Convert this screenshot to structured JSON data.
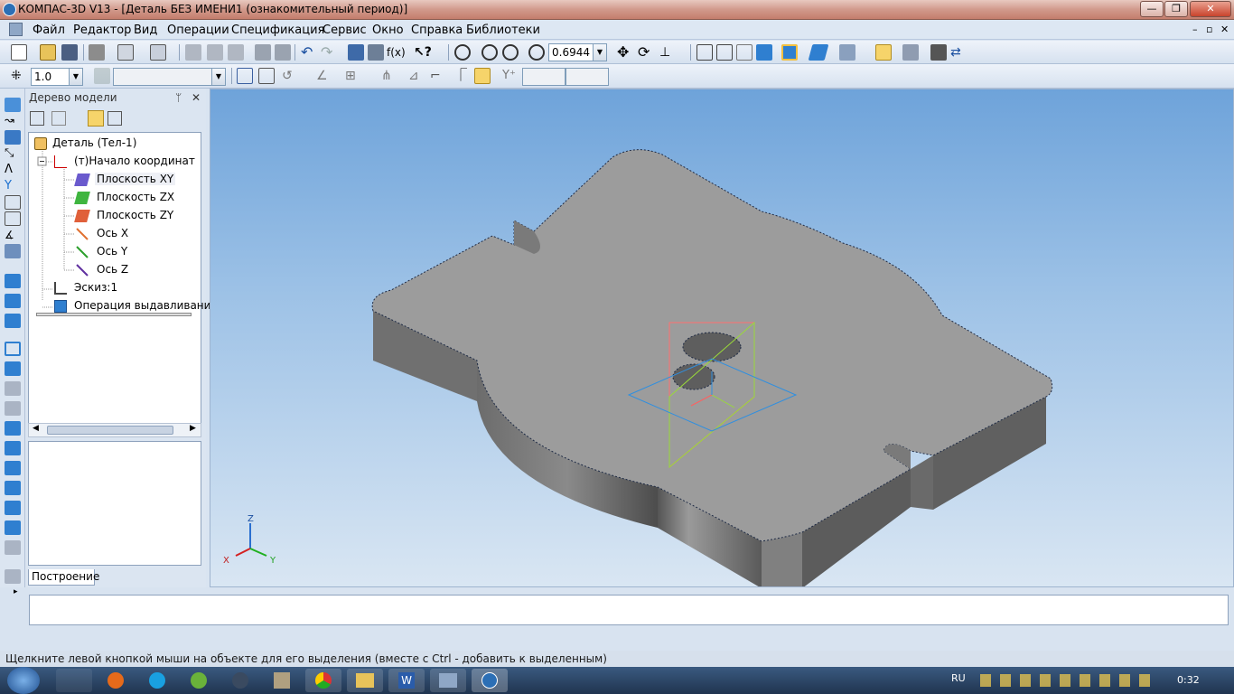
{
  "window": {
    "title": "КОМПАС-3D V13 - [Деталь БЕЗ ИМЕНИ1 (ознакомительный период)]",
    "minimize": "—",
    "maximize": "❐",
    "close": "✕"
  },
  "menu": [
    "Файл",
    "Редактор",
    "Вид",
    "Операции",
    "Спецификация",
    "Сервис",
    "Окно",
    "Справка",
    "Библиотеки"
  ],
  "toolbar1": {
    "zoom_value": "0.6944"
  },
  "toolbar2": {
    "step_value": "1.0"
  },
  "panel": {
    "title": "Дерево модели",
    "pin": "ᛘ",
    "close": "✕",
    "tab": "Построение"
  },
  "tree": [
    {
      "label": "Деталь (Тел-1)",
      "icon": "part-icon"
    },
    {
      "label": "(т)Начало координат",
      "icon": "origin-icon"
    },
    {
      "label": "Плоскость XY",
      "icon": "plane-xy-icon",
      "color": "#6a5acd"
    },
    {
      "label": "Плоскость ZX",
      "icon": "plane-zx-icon",
      "color": "#3fb53f"
    },
    {
      "label": "Плоскость ZY",
      "icon": "plane-zy-icon",
      "color": "#e0603a"
    },
    {
      "label": "Ось X",
      "icon": "axis-x-icon",
      "color": "#e07030"
    },
    {
      "label": "Ось Y",
      "icon": "axis-y-icon",
      "color": "#2ca02c"
    },
    {
      "label": "Ось Z",
      "icon": "axis-z-icon",
      "color": "#6030a0"
    },
    {
      "label": "Эскиз:1",
      "icon": "sketch-icon"
    },
    {
      "label": "Операция выдавливания",
      "icon": "extrusion-icon"
    }
  ],
  "axes_triad": {
    "x": "X",
    "y": "Y",
    "z": "Z"
  },
  "status_text": "Щелкните левой кнопкой мыши на объекте для его выделения (вместе с Ctrl - добавить к выделенным)",
  "tray": {
    "lang": "RU",
    "time": "0:32"
  },
  "colors": {
    "viewport_top": "#6ea3da",
    "part_face": "#9c9c9c",
    "part_side": "#7a7a7a"
  }
}
